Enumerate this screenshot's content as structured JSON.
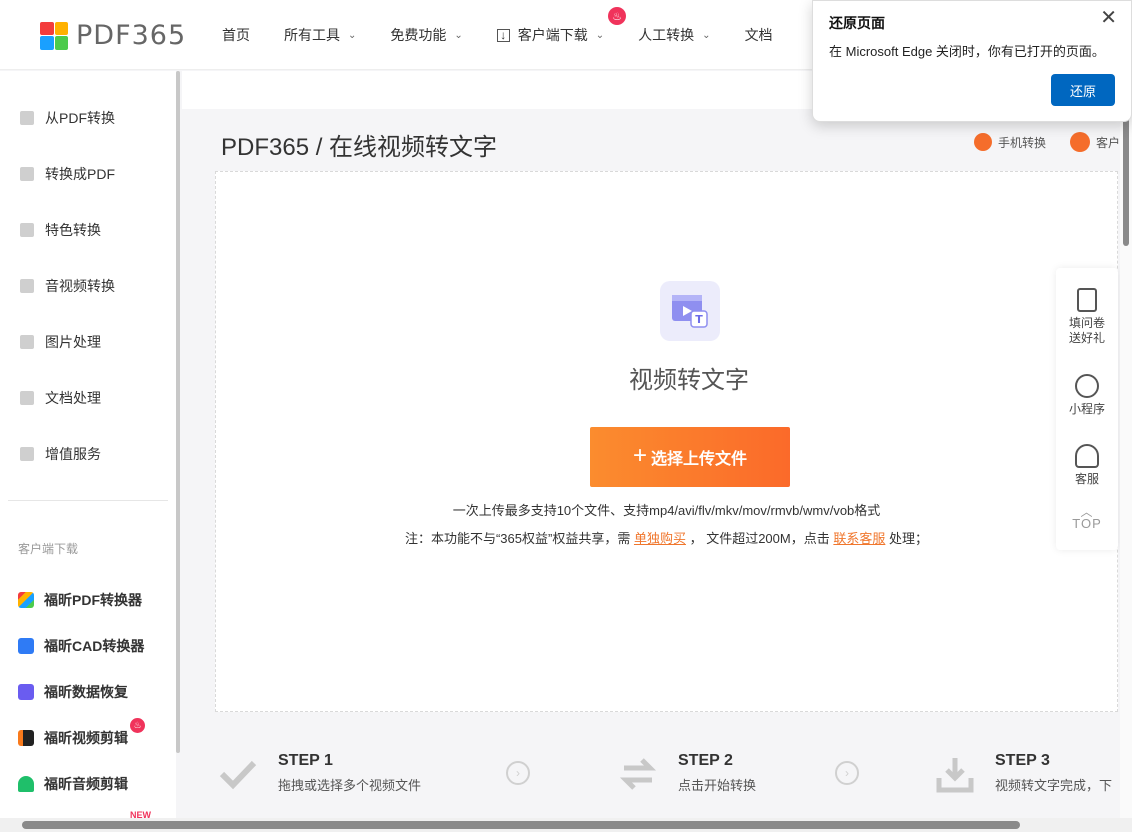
{
  "logo": {
    "text": "PDF365",
    "colors": [
      "#f33c3c",
      "#ffb100",
      "#1aa0ff",
      "#4ccb4c"
    ]
  },
  "nav": {
    "items": [
      "首页",
      "所有工具",
      "免费功能",
      "客户端下载",
      "人工转换",
      "文档"
    ]
  },
  "sidebar": {
    "items": [
      "从PDF转换",
      "转换成PDF",
      "特色转换",
      "音视频转换",
      "图片处理",
      "文档处理",
      "增值服务"
    ],
    "section_label": "客户端下载",
    "apps": [
      "福昕PDF转换器",
      "福昕CAD转换器",
      "福昕数据恢复",
      "福昕视频剪辑",
      "福昕音频剪辑"
    ],
    "new_badge": "NEW"
  },
  "main": {
    "breadcrumb": "PDF365 / 在线视频转文字",
    "link_mobile": "手机转换",
    "link_client": "客户",
    "upload_title": "视频转文字",
    "upload_button": "选择上传文件",
    "upload_plus": "+",
    "formats_note": "一次上传最多支持10个文件、支持mp4/avi/flv/mkv/mov/rmvb/wmv/vob格式",
    "note_prefix": "注：本功能不与“365权益”权益共享，需",
    "note_link1": "单独购买",
    "note_middle": "，  文件超过200M，点击",
    "note_link2": "联系客服",
    "note_suffix": "处理；"
  },
  "steps": [
    {
      "title": "STEP 1",
      "desc": "拖拽或选择多个视频文件"
    },
    {
      "title": "STEP 2",
      "desc": "点击开始转换"
    },
    {
      "title": "STEP 3",
      "desc": "视频转文字完成，下"
    }
  ],
  "float_panel": {
    "survey": "填问卷送好礼",
    "miniapp": "小程序",
    "service": "客服",
    "top": "TOP"
  },
  "popup": {
    "title": "还原页面",
    "message": "在 Microsoft Edge 关闭时，你有已打开的页面。",
    "button": "还原",
    "close": "✕"
  },
  "accent_color": "#fb7a2c"
}
